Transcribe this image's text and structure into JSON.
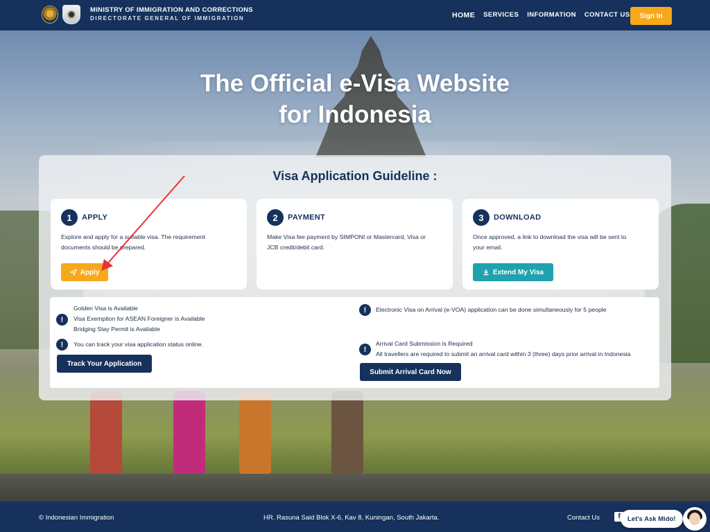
{
  "header": {
    "ministry_line1": "MINISTRY OF IMMIGRATION AND CORRECTIONS",
    "ministry_line2": "DIRECTORATE GENERAL OF IMMIGRATION",
    "nav": [
      "HOME",
      "SERVICES",
      "INFORMATION",
      "CONTACT US"
    ],
    "signin_label": "Sign In"
  },
  "hero": {
    "title_line1": "The Official e-Visa Website",
    "title_line2": "for Indonesia"
  },
  "guideline": {
    "title": "Visa Application Guideline :",
    "steps": [
      {
        "number": "1",
        "title": "APPLY",
        "desc": "Explore and apply for a suitable visa. The requirement documents should be prepared.",
        "button": "Apply"
      },
      {
        "number": "2",
        "title": "PAYMENT",
        "desc": "Make Visa fee payment by SIMPONI or Mastercard, Visa or JCB credit/debit card."
      },
      {
        "number": "3",
        "title": "DOWNLOAD",
        "desc": "Once approved, a link to download the visa will be sent to your email.",
        "button": "Extend My Visa"
      }
    ]
  },
  "notices": {
    "left_block1": [
      "Golden Visa is Available",
      "Visa Exemption for ASEAN Foreigner is Available",
      "Bridging Stay Permit is Available"
    ],
    "left_block2": "You can track your visa application status online.",
    "track_button": "Track Your Application",
    "right_block1": "Electronic Visa on Arrival (e-VOA) application can be done simultaneously for 5 people",
    "right_block2_title": "Arrival Card Submission is Required",
    "right_block2_text": "All travellers are required to submit an arrival card within 3 (three) days prior arrival in Indonesia",
    "arrival_button": "Submit Arrival Card Now",
    "icon_glyph": "!"
  },
  "footer": {
    "copyright": "© Indonesian Immigration",
    "address": "HR. Rasuna Said Blok X-6, Kav 8, Kuningan, South Jakarta.",
    "contact": "Contact Us",
    "facebook_glyph": "f"
  },
  "chat": {
    "label": "Let's Ask Mido!"
  },
  "colors": {
    "navy": "#15315c",
    "orange": "#f7a81b",
    "teal": "#1fa2ae",
    "arrow": "#e8323a"
  },
  "icons": {
    "apply": "send-icon",
    "extend": "download-icon",
    "notice": "exclamation-icon"
  }
}
